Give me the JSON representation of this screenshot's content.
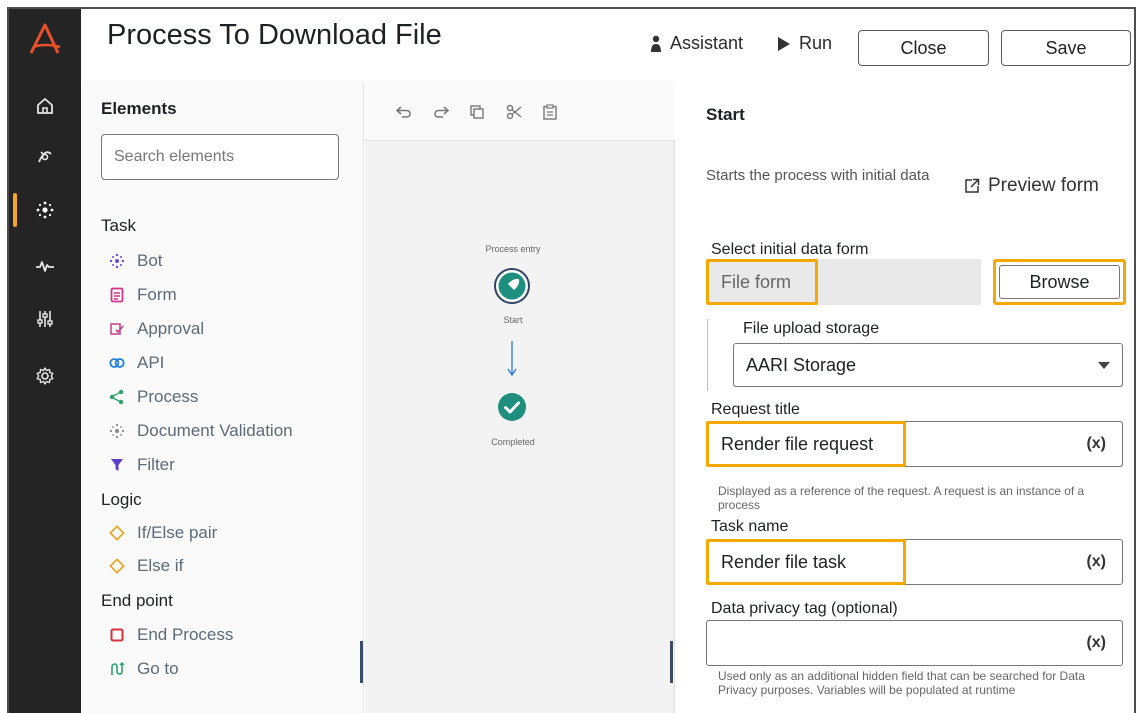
{
  "header": {
    "title": "Process To Download File",
    "assistant_label": "Assistant",
    "run_label": "Run",
    "close_label": "Close",
    "save_label": "Save"
  },
  "nav": {
    "items": [
      "home-icon",
      "bot-agent-icon",
      "automation-icon",
      "activity-icon",
      "admin-sliders-icon",
      "settings-gear-icon"
    ],
    "active_index": 2,
    "accent_color": "#f5a623"
  },
  "elements": {
    "title": "Elements",
    "search_placeholder": "Search elements",
    "groups": {
      "task": {
        "label": "Task",
        "items": [
          {
            "label": "Bot",
            "icon": "bot-icon"
          },
          {
            "label": "Form",
            "icon": "form-icon"
          },
          {
            "label": "Approval",
            "icon": "approval-icon"
          },
          {
            "label": "API",
            "icon": "api-icon"
          },
          {
            "label": "Process",
            "icon": "process-icon"
          },
          {
            "label": "Document Validation",
            "icon": "document-validation-icon"
          },
          {
            "label": "Filter",
            "icon": "filter-icon"
          }
        ]
      },
      "logic": {
        "label": "Logic",
        "items": [
          {
            "label": "If/Else pair",
            "icon": "if-else-diamond-icon"
          },
          {
            "label": "Else if",
            "icon": "else-if-diamond-icon"
          }
        ]
      },
      "end": {
        "label": "End point",
        "items": [
          {
            "label": "End Process",
            "icon": "end-process-icon"
          },
          {
            "label": "Go to",
            "icon": "go-to-icon"
          }
        ]
      }
    }
  },
  "canvas": {
    "toolbar": [
      "undo-icon",
      "redo-icon",
      "copy-icon",
      "cut-icon",
      "paste-icon"
    ],
    "entry_label": "Process entry",
    "start_label": "Start",
    "completed_label": "Completed"
  },
  "properties": {
    "title": "Start",
    "description": "Starts the process with initial data",
    "preview_label": "Preview form",
    "initial_form_label": "Select initial data form",
    "initial_form_value": "File form",
    "browse_label": "Browse",
    "storage_label": "File upload storage",
    "storage_value": "AARI Storage",
    "request_title_label": "Request title",
    "request_title_value": "Render file request",
    "request_title_help": "Displayed as a reference of the request. A request is an instance of a process",
    "task_name_label": "Task name",
    "task_name_value": "Render file task",
    "privacy_label": "Data privacy tag (optional)",
    "privacy_value": "",
    "privacy_help": "Used only as an additional hidden field that can be searched for Data Privacy purposes. Variables will be populated at runtime",
    "variable_button": "(x)",
    "highlight_color": "#f5a800"
  }
}
